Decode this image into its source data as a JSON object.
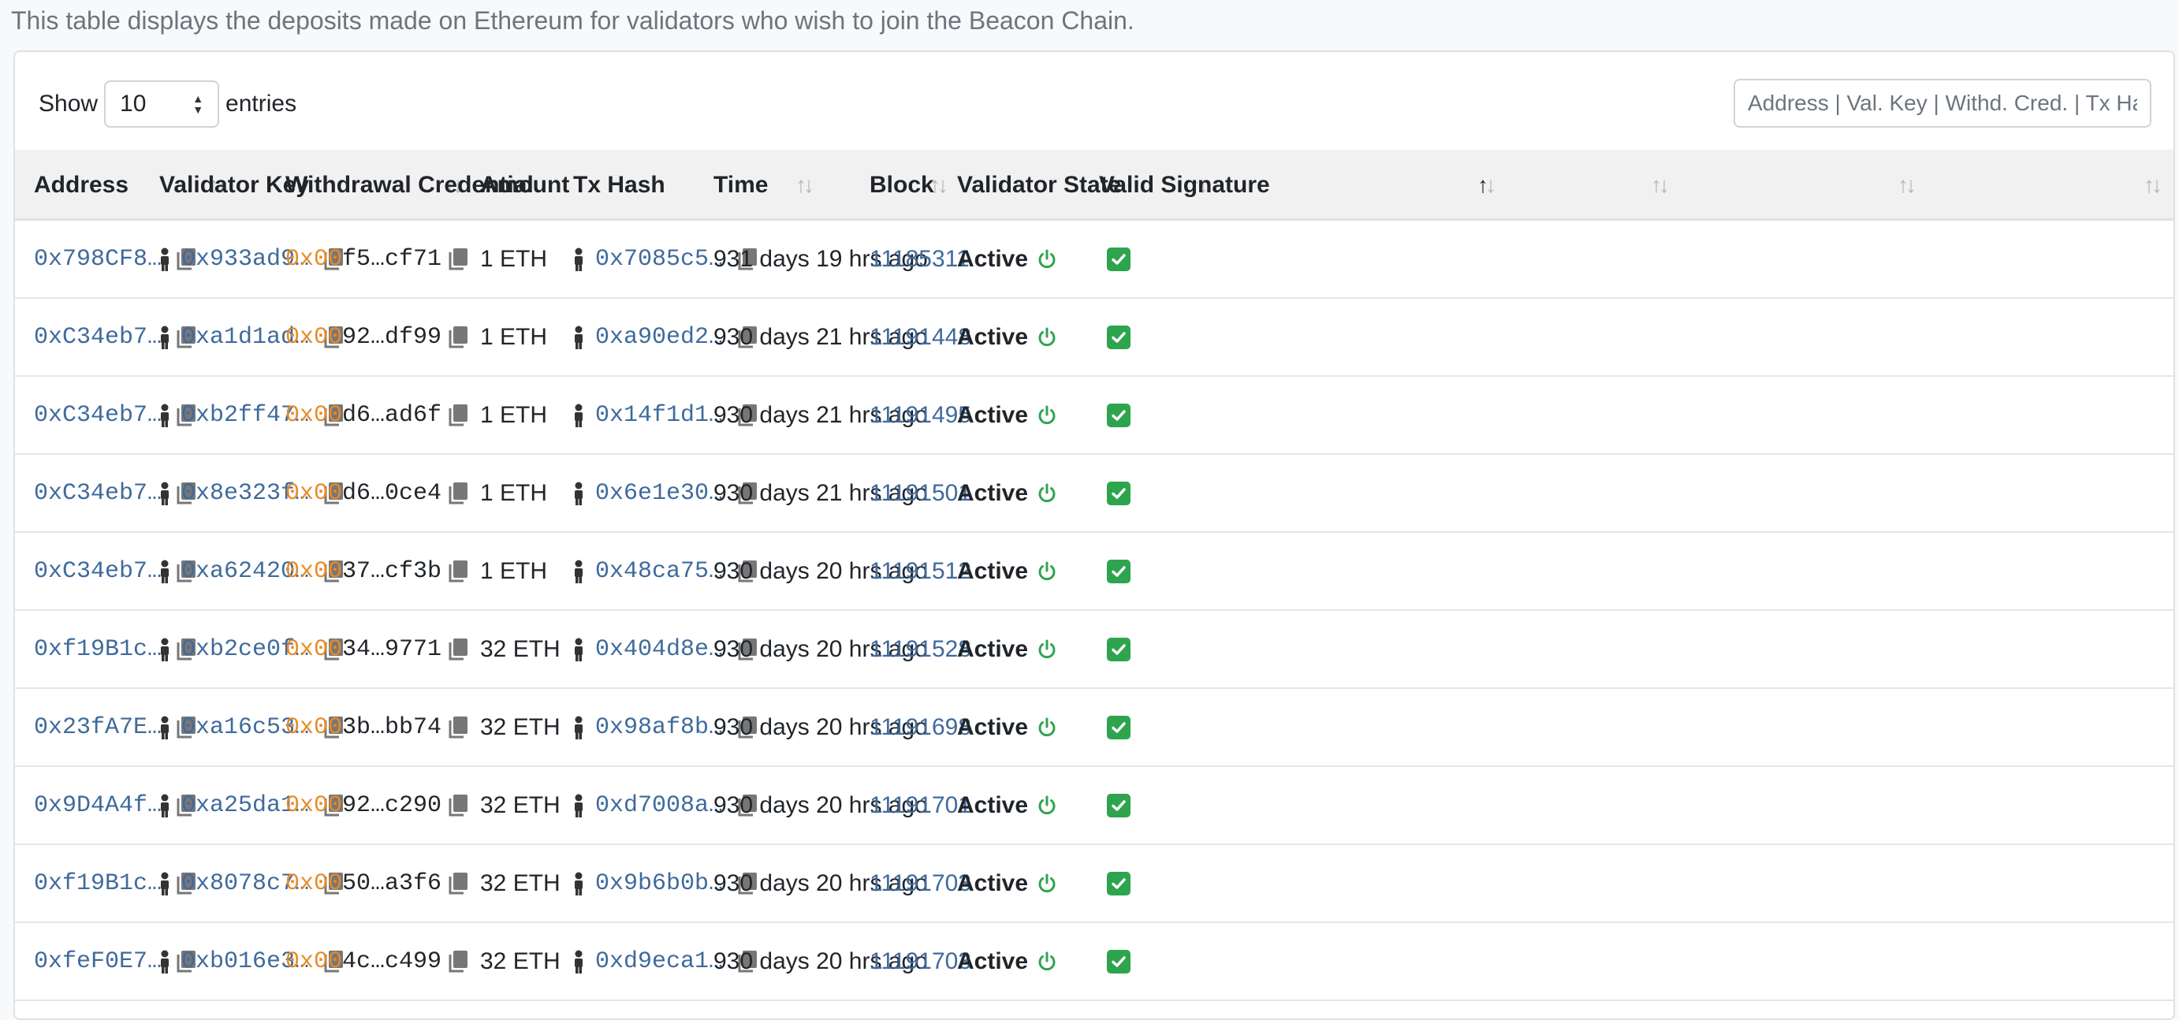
{
  "intro": "This table displays the deposits made on Ethereum for validators who wish to join the Beacon Chain.",
  "controls": {
    "show_label": "Show",
    "entries_value": "10",
    "entries_label": "entries",
    "search_placeholder": "Address | Val. Key | Withd. Cred. | Tx Hash"
  },
  "columns": [
    "Address",
    "Validator Key",
    "Withdrawal Credential",
    "Amount",
    "Tx Hash",
    "Time",
    "Block",
    "Validator State",
    "Valid Signature"
  ],
  "sort": {
    "column": "Time",
    "direction": "ascending"
  },
  "colors": {
    "link": "#3f6a9c",
    "credential_prefix": "#e88b25",
    "active_icon": "#2ea44f",
    "check_bg": "#2ea44f"
  },
  "rows": [
    {
      "address": "0x798CF8…",
      "validator_key": "0x933ad9…",
      "wc_prefix": "0x00",
      "wc_rest": "f5…cf71",
      "amount": "1 ETH",
      "tx_hash": "0x7085c5…",
      "time": "931 days 19 hrs ago",
      "block": "11185311",
      "state": "Active",
      "valid": "✅"
    },
    {
      "address": "0xC34eb7…",
      "validator_key": "0xa1d1ad…",
      "wc_prefix": "0x00",
      "wc_rest": "92…df99",
      "amount": "1 ETH",
      "tx_hash": "0xa90ed2…",
      "time": "930 days 21 hrs ago",
      "block": "11191448",
      "state": "Active",
      "valid": "✅"
    },
    {
      "address": "0xC34eb7…",
      "validator_key": "0xb2ff47…",
      "wc_prefix": "0x00",
      "wc_rest": "d6…ad6f",
      "amount": "1 ETH",
      "tx_hash": "0x14f1d1…",
      "time": "930 days 21 hrs ago",
      "block": "11191495",
      "state": "Active",
      "valid": "✅"
    },
    {
      "address": "0xC34eb7…",
      "validator_key": "0x8e323f…",
      "wc_prefix": "0x00",
      "wc_rest": "d6…0ce4",
      "amount": "1 ETH",
      "tx_hash": "0x6e1e30…",
      "time": "930 days 21 hrs ago",
      "block": "11191501",
      "state": "Active",
      "valid": "✅"
    },
    {
      "address": "0xC34eb7…",
      "validator_key": "0xa62420…",
      "wc_prefix": "0x00",
      "wc_rest": "37…cf3b",
      "amount": "1 ETH",
      "tx_hash": "0x48ca75…",
      "time": "930 days 20 hrs ago",
      "block": "11191512",
      "state": "Active",
      "valid": "✅"
    },
    {
      "address": "0xf19B1c…",
      "validator_key": "0xb2ce0f…",
      "wc_prefix": "0x00",
      "wc_rest": "34…9771",
      "amount": "32 ETH",
      "tx_hash": "0x404d8e…",
      "time": "930 days 20 hrs ago",
      "block": "11191528",
      "state": "Active",
      "valid": "✅"
    },
    {
      "address": "0x23fA7E…",
      "validator_key": "0xa16c53…",
      "wc_prefix": "0x00",
      "wc_rest": "3b…bb74",
      "amount": "32 ETH",
      "tx_hash": "0x98af8b…",
      "time": "930 days 20 hrs ago",
      "block": "11191698",
      "state": "Active",
      "valid": "✅"
    },
    {
      "address": "0x9D4A4f…",
      "validator_key": "0xa25da1…",
      "wc_prefix": "0x00",
      "wc_rest": "92…c290",
      "amount": "32 ETH",
      "tx_hash": "0xd7008a…",
      "time": "930 days 20 hrs ago",
      "block": "11191701",
      "state": "Active",
      "valid": "✅"
    },
    {
      "address": "0xf19B1c…",
      "validator_key": "0x8078c7…",
      "wc_prefix": "0x00",
      "wc_rest": "50…a3f6",
      "amount": "32 ETH",
      "tx_hash": "0x9b6b0b…",
      "time": "930 days 20 hrs ago",
      "block": "11191703",
      "state": "Active",
      "valid": "✅"
    },
    {
      "address": "0xfeF0E7…",
      "validator_key": "0xb016e3…",
      "wc_prefix": "0x00",
      "wc_rest": "4c…c499",
      "amount": "32 ETH",
      "tx_hash": "0xd9eca1…",
      "time": "930 days 20 hrs ago",
      "block": "11191703",
      "state": "Active",
      "valid": "✅"
    }
  ]
}
